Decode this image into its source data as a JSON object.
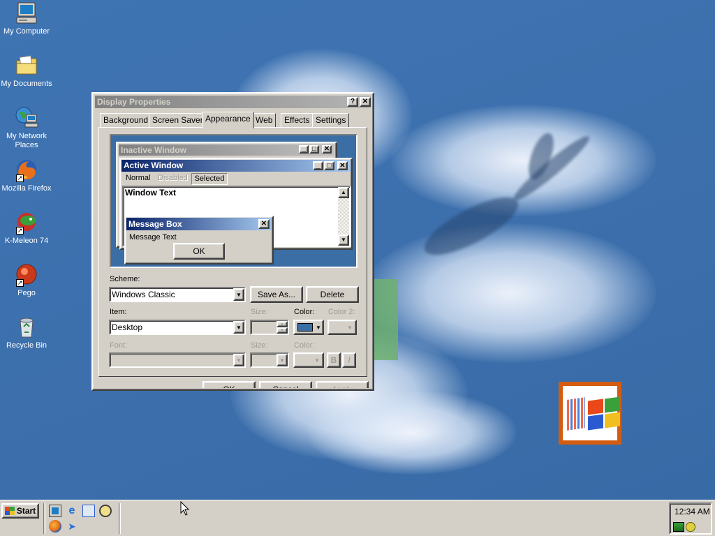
{
  "desktop_icons": [
    {
      "label": "My Computer"
    },
    {
      "label": "My Documents"
    },
    {
      "label": "My Network Places"
    },
    {
      "label": "Mozilla Firefox"
    },
    {
      "label": "K-Meleon 74"
    },
    {
      "label": "Pego"
    },
    {
      "label": "Recycle Bin"
    }
  ],
  "dialog": {
    "title": "Display Properties",
    "help_glyph": "?",
    "close_glyph": "✕",
    "tabs": [
      "Background",
      "Screen Saver",
      "Appearance",
      "Web",
      "Effects",
      "Settings"
    ],
    "active_tab": "Appearance",
    "preview": {
      "inactive_title": "Inactive Window",
      "active_title": "Active Window",
      "menu_items": [
        "Normal",
        "Disabled",
        "Selected"
      ],
      "window_text": "Window Text",
      "message_box_title": "Message Box",
      "message_text": "Message Text",
      "ok_label": "OK"
    },
    "scheme_label": "Scheme:",
    "scheme_value": "Windows Classic",
    "save_as_label": "Save As...",
    "delete_label": "Delete",
    "item_label": "Item:",
    "item_value": "Desktop",
    "size_label": "Size:",
    "color_label": "Color:",
    "color2_label": "Color 2:",
    "font_label": "Font:",
    "font_size_label": "Size:",
    "font_color_label": "Color:",
    "bold_label": "B",
    "italic_label": "I",
    "ok_button": "OK",
    "cancel_button": "Cancel",
    "apply_button": "Apply",
    "desktop_color": "#3a6ea5"
  },
  "taskbar": {
    "start_label": "Start",
    "clock": "12:34 AM"
  },
  "colors": {
    "active_title_start": "#0a246a",
    "active_title_end": "#a6caf0",
    "inactive_title_start": "#808080",
    "inactive_title_end": "#c0c0c0",
    "logo_frame": "#d45c10"
  }
}
